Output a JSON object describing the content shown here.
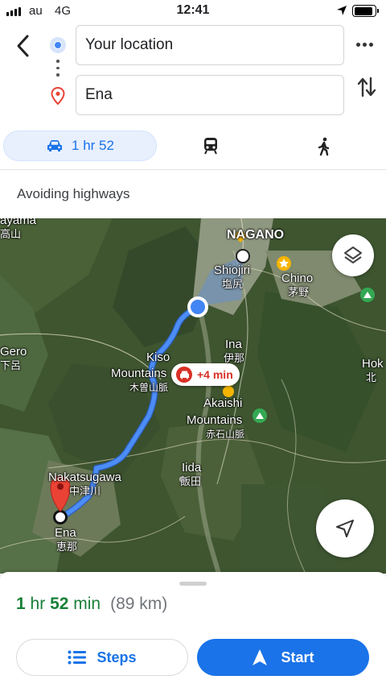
{
  "status_bar": {
    "carrier": "au",
    "network": "4G",
    "time": "12:41",
    "battery_level": 0.9,
    "icons": [
      "signal-bars-icon",
      "location-arrow-icon",
      "battery-icon"
    ]
  },
  "directions": {
    "origin": "Your location",
    "destination": "Ena",
    "icons": [
      "back-arrow-icon",
      "more-options-icon",
      "swap-icon"
    ]
  },
  "modes": {
    "drive_label": "1 hr 52",
    "selected": "drive",
    "icons": [
      "car-icon",
      "train-icon",
      "walk-icon"
    ]
  },
  "route_note": "Avoiding highways",
  "map": {
    "labels": {
      "nagano": "NAGANO",
      "shiojiri": "Shiojiri",
      "shiojiri_jp": "塩尻",
      "chino": "Chino",
      "chino_jp": "茅野",
      "ina": "Ina",
      "ina_jp": "伊那",
      "kiso": "Kiso",
      "mountains_left": "Mountains",
      "kiso_jp": "木曽山脈",
      "akaishi": "Akaishi",
      "mountains_right": "Mountains",
      "akaishi_jp": "赤石山脈",
      "iida": "Iida",
      "iida_jp": "飯田",
      "nakatsugawa": "Nakatsugawa",
      "nakatsugawa_jp": "中津川",
      "ena": "Ena",
      "ena_jp": "恵那",
      "gero": "Gero",
      "gero_jp": "下呂",
      "takayama": "ayama",
      "takayama_jp": "高山",
      "hok": "Hok",
      "hok_jp": "北"
    },
    "traffic_delay": "+4 min",
    "colors": {
      "route": "#4c8df6",
      "traffic": "#d93025",
      "pin": "#ea4335"
    }
  },
  "sheet": {
    "duration_hr": "1",
    "duration_hr_unit": "hr",
    "duration_min": "52",
    "duration_min_unit": "min",
    "distance": "(89 km)",
    "steps_label": "Steps",
    "start_label": "Start"
  }
}
